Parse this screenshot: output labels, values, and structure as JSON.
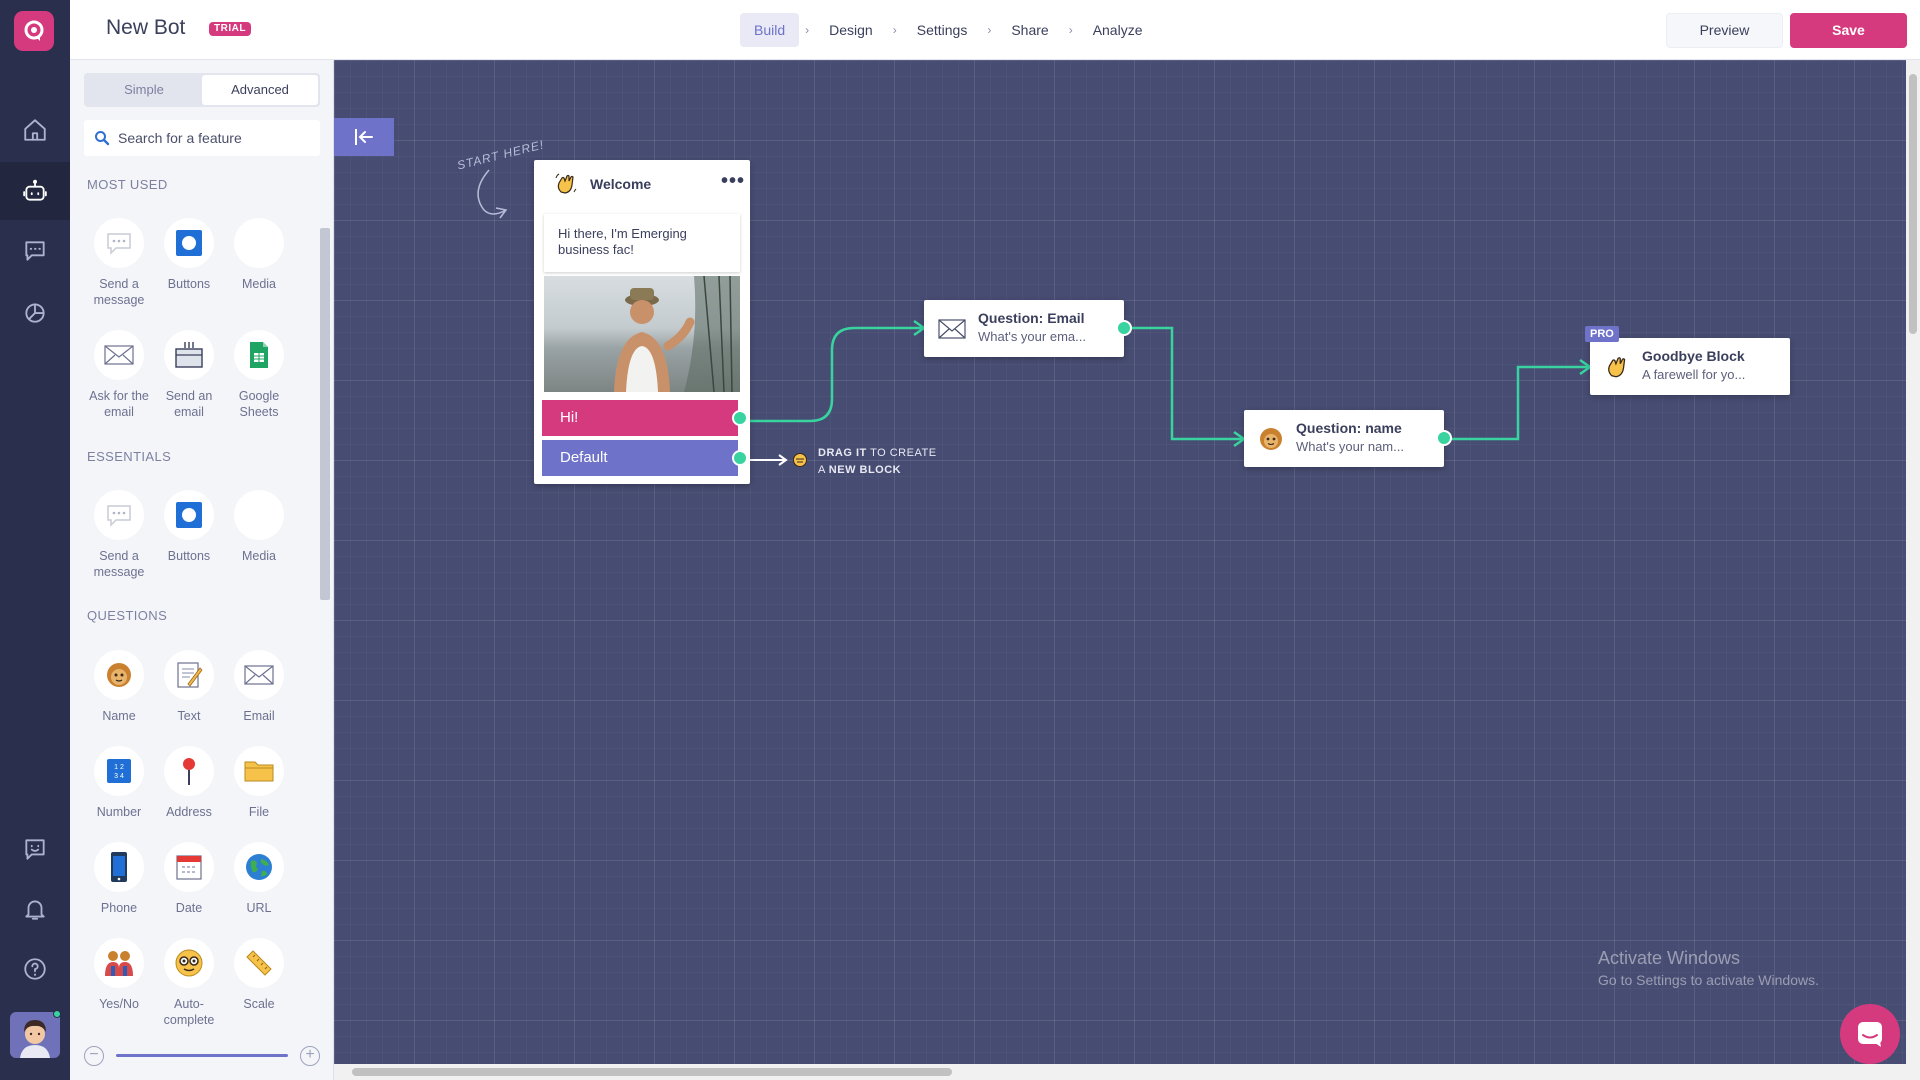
{
  "app": {
    "bot_name": "New Bot",
    "plan_badge": "TRIAL"
  },
  "nav": {
    "steps": [
      {
        "label": "Build",
        "active": true
      },
      {
        "label": "Design"
      },
      {
        "label": "Settings"
      },
      {
        "label": "Share"
      },
      {
        "label": "Analyze"
      }
    ],
    "separator": "›",
    "preview_label": "Preview",
    "save_label": "Save"
  },
  "rail": {
    "icons": [
      "logo-icon",
      "home-icon",
      "bot-icon",
      "conversations-icon",
      "analytics-icon",
      "feedback-icon",
      "bell-icon",
      "help-icon",
      "user-avatar"
    ],
    "active": "bot-icon"
  },
  "panel": {
    "tabs": {
      "simple": "Simple",
      "advanced": "Advanced",
      "active": "Advanced"
    },
    "search_placeholder": "Search for a feature",
    "sections": {
      "most_used": {
        "title": "MOST USED",
        "items": [
          {
            "label": "Send a message",
            "icon": "speech-bubble-icon"
          },
          {
            "label": "Buttons",
            "icon": "button-icon"
          },
          {
            "label": "Media",
            "icon": "media-icon"
          },
          {
            "label": "Ask for the email",
            "icon": "envelope-icon"
          },
          {
            "label": "Send an email",
            "icon": "outbox-icon"
          },
          {
            "label": "Google Sheets",
            "icon": "google-sheets-icon"
          }
        ]
      },
      "essentials": {
        "title": "ESSENTIALS",
        "items": [
          {
            "label": "Send a message",
            "icon": "speech-bubble-icon"
          },
          {
            "label": "Buttons",
            "icon": "button-icon"
          },
          {
            "label": "Media",
            "icon": "media-icon"
          }
        ]
      },
      "questions": {
        "title": "QUESTIONS",
        "items": [
          {
            "label": "Name",
            "icon": "face-icon"
          },
          {
            "label": "Text",
            "icon": "memo-icon"
          },
          {
            "label": "Email",
            "icon": "envelope-icon"
          },
          {
            "label": "Number",
            "icon": "numbers-icon"
          },
          {
            "label": "Address",
            "icon": "pin-icon"
          },
          {
            "label": "File",
            "icon": "folder-icon"
          },
          {
            "label": "Phone",
            "icon": "phone-icon"
          },
          {
            "label": "Date",
            "icon": "calendar-icon"
          },
          {
            "label": "URL",
            "icon": "globe-icon"
          },
          {
            "label": "Yes/No",
            "icon": "people-icon"
          },
          {
            "label": "Auto-complete",
            "icon": "glasses-face-icon"
          },
          {
            "label": "Scale",
            "icon": "ruler-icon"
          }
        ]
      }
    }
  },
  "canvas": {
    "start_hint": "START HERE!",
    "drag_hint": {
      "strong1": "DRAG IT",
      "rest1": " TO CREATE",
      "rest2": "A ",
      "strong2": "NEW BLOCK"
    },
    "welcome": {
      "title": "Welcome",
      "message": "Hi there, I'm Emerging business fac!",
      "options": [
        {
          "label": "Hi!"
        },
        {
          "label": "Default"
        }
      ]
    },
    "q_email": {
      "title": "Question: Email",
      "subtitle": "What's your ema..."
    },
    "q_name": {
      "title": "Question: name",
      "subtitle": "What's your nam..."
    },
    "goodbye": {
      "title": "Goodbye Block",
      "subtitle": "A farewell for yo...",
      "badge": "PRO"
    },
    "watermark": {
      "line1": "Activate Windows",
      "line2": "Go to Settings to activate Windows."
    }
  },
  "colors": {
    "brand": "#d63a7e",
    "accent": "#6e72c8",
    "canvas": "#474c72",
    "connector": "#38d39f",
    "rail": "#2b2f4e"
  }
}
